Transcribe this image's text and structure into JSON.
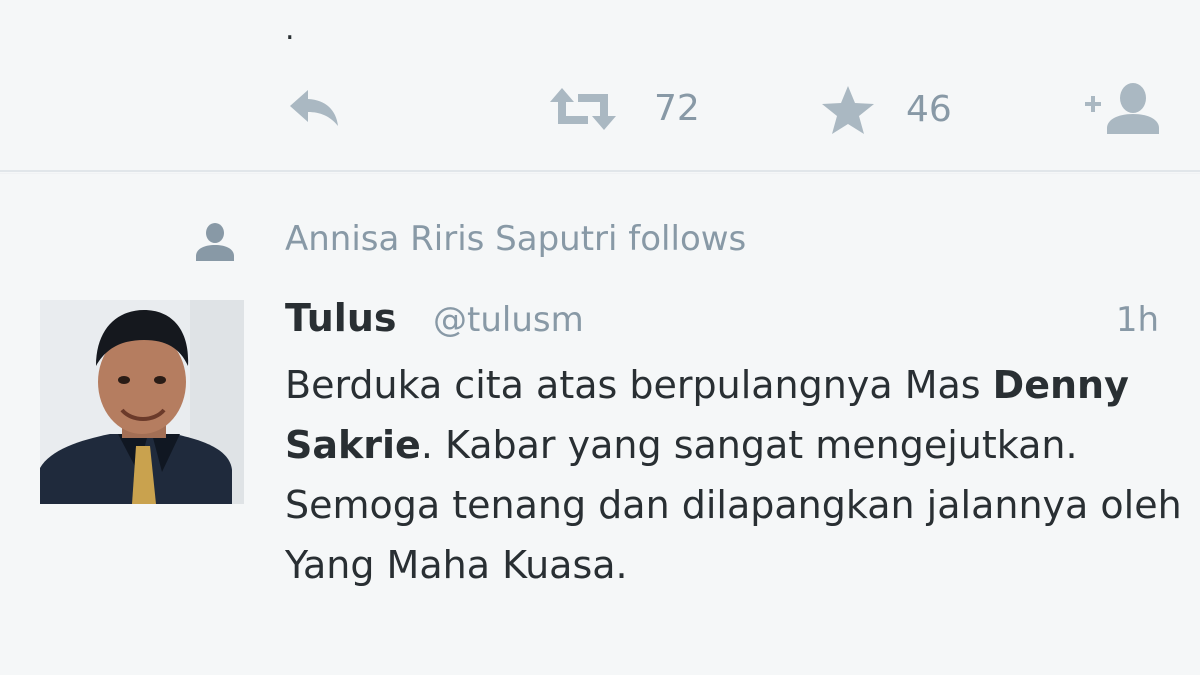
{
  "previous_tweet": {
    "text": ".",
    "actions": {
      "retweet_count": "72",
      "favorite_count": "46"
    }
  },
  "social_context": {
    "text": "Annisa Riris Saputri follows",
    "icon": "person-icon"
  },
  "tweet": {
    "display_name": "Tulus",
    "handle": "@tulusm",
    "timestamp": "1h",
    "text_part1": "Berduka cita atas berpulangnya Mas",
    "mention": "Denny Sakrie",
    "text_part2": ". Kabar yang sangat mengejutkan. Semoga tenang dan dilapangkan jalannya oleh Yang Maha Kuasa."
  },
  "colors": {
    "background": "#f5f7f8",
    "text": "#292f33",
    "secondary_text": "#8899a6",
    "icon": "#aab8c2",
    "divider": "#e1e6ea"
  }
}
